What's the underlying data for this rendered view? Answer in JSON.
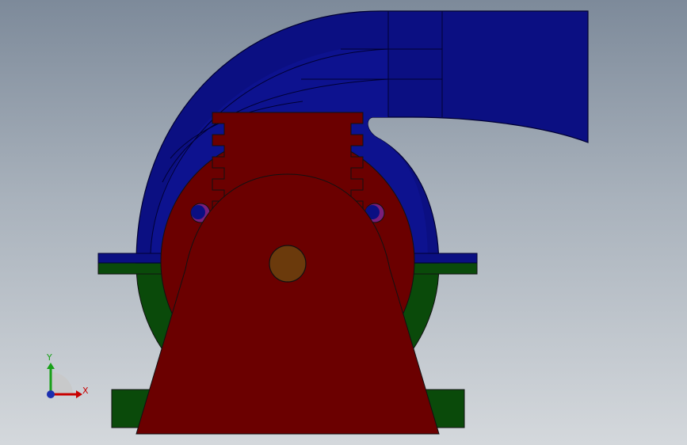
{
  "viewport": {
    "background_top": "#7d8a9a",
    "background_bottom": "#d4d8dc"
  },
  "colors": {
    "volute_blue": "#0b0f82",
    "volute_edge": "#000033",
    "housing_red": "#6b0000",
    "base_green": "#0a4a0a",
    "shaft_brown": "#6b3a0c",
    "bolt_purple": "#7a1e7a",
    "outline": "#111111"
  },
  "triad": {
    "x_label": "X",
    "y_label": "Y",
    "x_color": "#c80000",
    "y_color": "#18a018",
    "z_color": "#1c2fb0"
  }
}
